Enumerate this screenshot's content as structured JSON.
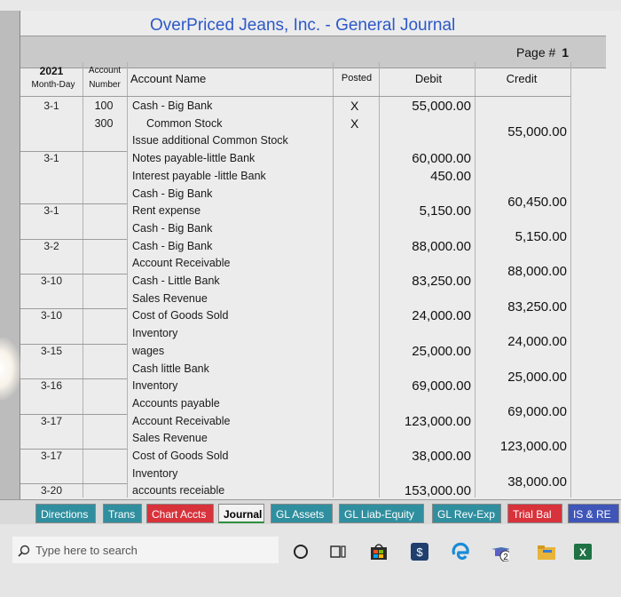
{
  "journal": {
    "title": "OverPriced Jeans, Inc.  -  General Journal",
    "page_label": "Page #",
    "page_number": "1",
    "headers": {
      "year": "2021",
      "month_day": "Month-Day",
      "account_number_line1": "Account",
      "account_number_line2": "Number",
      "account_name": "Account Name",
      "posted": "Posted",
      "debit": "Debit",
      "credit": "Credit"
    },
    "rows": [
      {
        "date": "3-1",
        "acct_no": "100",
        "name": "Cash - Big Bank",
        "posted": "X",
        "debit": "55,000.00",
        "credit": ""
      },
      {
        "date": "",
        "acct_no": "300",
        "name": "Common Stock",
        "posted": "X",
        "debit": "",
        "credit": "55,000.00"
      },
      {
        "date": "",
        "acct_no": "",
        "name": "Issue additional Common Stock",
        "posted": "",
        "debit": "",
        "credit": ""
      },
      {
        "date": "3-1",
        "acct_no": "",
        "name": "Notes payable-little Bank",
        "posted": "",
        "debit": "60,000.00",
        "credit": ""
      },
      {
        "date": "",
        "acct_no": "",
        "name": "Interest payable -little Bank",
        "posted": "",
        "debit": "450.00",
        "credit": ""
      },
      {
        "date": "",
        "acct_no": "",
        "name": "Cash - Big Bank",
        "posted": "",
        "debit": "",
        "credit": "60,450.00"
      },
      {
        "date": "3-1",
        "acct_no": "",
        "name": "Rent expense",
        "posted": "",
        "debit": "5,150.00",
        "credit": ""
      },
      {
        "date": "",
        "acct_no": "",
        "name": "Cash - Big Bank",
        "posted": "",
        "debit": "",
        "credit": "5,150.00"
      },
      {
        "date": "3-2",
        "acct_no": "",
        "name": "Cash - Big Bank",
        "posted": "",
        "debit": "88,000.00",
        "credit": ""
      },
      {
        "date": "",
        "acct_no": "",
        "name": "Account Receivable",
        "posted": "",
        "debit": "",
        "credit": "88,000.00"
      },
      {
        "date": "3-10",
        "acct_no": "",
        "name": "Cash - Little Bank",
        "posted": "",
        "debit": "83,250.00",
        "credit": ""
      },
      {
        "date": "",
        "acct_no": "",
        "name": "Sales Revenue",
        "posted": "",
        "debit": "",
        "credit": "83,250.00"
      },
      {
        "date": "3-10",
        "acct_no": "",
        "name": "Cost of Goods Sold",
        "posted": "",
        "debit": "24,000.00",
        "credit": ""
      },
      {
        "date": "",
        "acct_no": "",
        "name": "Inventory",
        "posted": "",
        "debit": "",
        "credit": "24,000.00"
      },
      {
        "date": "3-15",
        "acct_no": "",
        "name": "wages",
        "posted": "",
        "debit": "25,000.00",
        "credit": ""
      },
      {
        "date": "",
        "acct_no": "",
        "name": "Cash little Bank",
        "posted": "",
        "debit": "",
        "credit": "25,000.00"
      },
      {
        "date": "3-16",
        "acct_no": "",
        "name": "Inventory",
        "posted": "",
        "debit": "69,000.00",
        "credit": ""
      },
      {
        "date": "",
        "acct_no": "",
        "name": "Accounts payable",
        "posted": "",
        "debit": "",
        "credit": "69,000.00"
      },
      {
        "date": "3-17",
        "acct_no": "",
        "name": "Account Receivable",
        "posted": "",
        "debit": "123,000.00",
        "credit": ""
      },
      {
        "date": "",
        "acct_no": "",
        "name": "Sales Revenue",
        "posted": "",
        "debit": "",
        "credit": "123,000.00"
      },
      {
        "date": "3-17",
        "acct_no": "",
        "name": "Cost of Goods Sold",
        "posted": "",
        "debit": "38,000.00",
        "credit": ""
      },
      {
        "date": "",
        "acct_no": "",
        "name": "Inventory",
        "posted": "",
        "debit": "",
        "credit": "38,000.00"
      },
      {
        "date": "3-20",
        "acct_no": "",
        "name": "accounts receiable",
        "posted": "",
        "debit": "153,000.00",
        "credit": ""
      }
    ]
  },
  "sheet_tabs": [
    {
      "label": "Directions",
      "bg": "#2f8f9f",
      "fg": "#ffffff"
    },
    {
      "label": "Trans",
      "bg": "#2f8f9f",
      "fg": "#ffffff"
    },
    {
      "label": "Chart Accts",
      "bg": "#d8323b",
      "fg": "#ffffff"
    },
    {
      "label": "Journal",
      "bg": "#f2f2f2",
      "fg": "#000000"
    },
    {
      "label": "GL Assets",
      "bg": "#2f8f9f",
      "fg": "#ffffff"
    },
    {
      "label": "GL Liab-Equity",
      "bg": "#2f8f9f",
      "fg": "#ffffff"
    },
    {
      "label": "GL Rev-Exp",
      "bg": "#2f8f9f",
      "fg": "#ffffff"
    },
    {
      "label": "Trial Bal",
      "bg": "#d8323b",
      "fg": "#ffffff"
    },
    {
      "label": "IS & RE",
      "bg": "#3f55b8",
      "fg": "#ffffff"
    }
  ],
  "taskbar": {
    "search_placeholder": "Type here to search",
    "icons": [
      "cortana-circle-icon",
      "task-view-icon",
      "store-icon",
      "tradingview-icon",
      "edge-icon",
      "teams-icon",
      "file-explorer-icon",
      "excel-icon"
    ],
    "badge_count": "2"
  },
  "colors": {
    "title": "#2c58c8",
    "teal_tab": "#2f8f9f",
    "red_tab": "#d8323b",
    "blue_tab": "#3f55b8"
  }
}
